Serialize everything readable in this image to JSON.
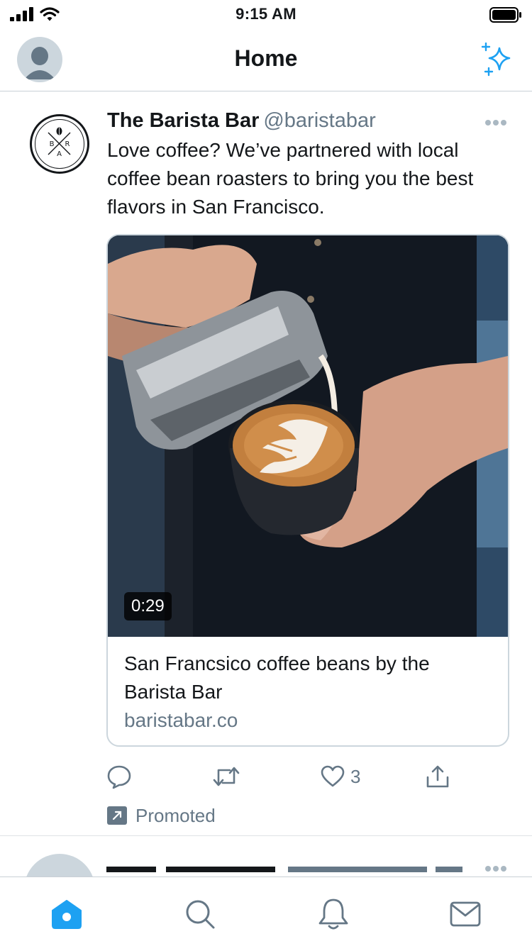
{
  "status_bar": {
    "time": "9:15 AM"
  },
  "header": {
    "title": "Home",
    "profile_icon": "avatar-placeholder",
    "action_icon": "sparkle-icon"
  },
  "tweet": {
    "display_name": "The Barista Bar",
    "handle": "@baristabar",
    "avatar_letters": [
      "B",
      "R",
      "A"
    ],
    "text": "Love coffee? We’ve partnered with local coffee bean roasters to bring you the best flavors in San Francisco.",
    "card": {
      "duration": "0:29",
      "title": "San Francsico coffee beans by the Barista Bar",
      "domain": "baristabar.co"
    },
    "actions": {
      "like_count": "3"
    },
    "promoted_label": "Promoted"
  },
  "tab_bar": {
    "tabs": [
      "home",
      "search",
      "notifications",
      "messages"
    ],
    "active": "home"
  },
  "colors": {
    "accent": "#1da1f2",
    "text": "#14171a",
    "secondary": "#657786",
    "divider": "#ccd6dd"
  }
}
